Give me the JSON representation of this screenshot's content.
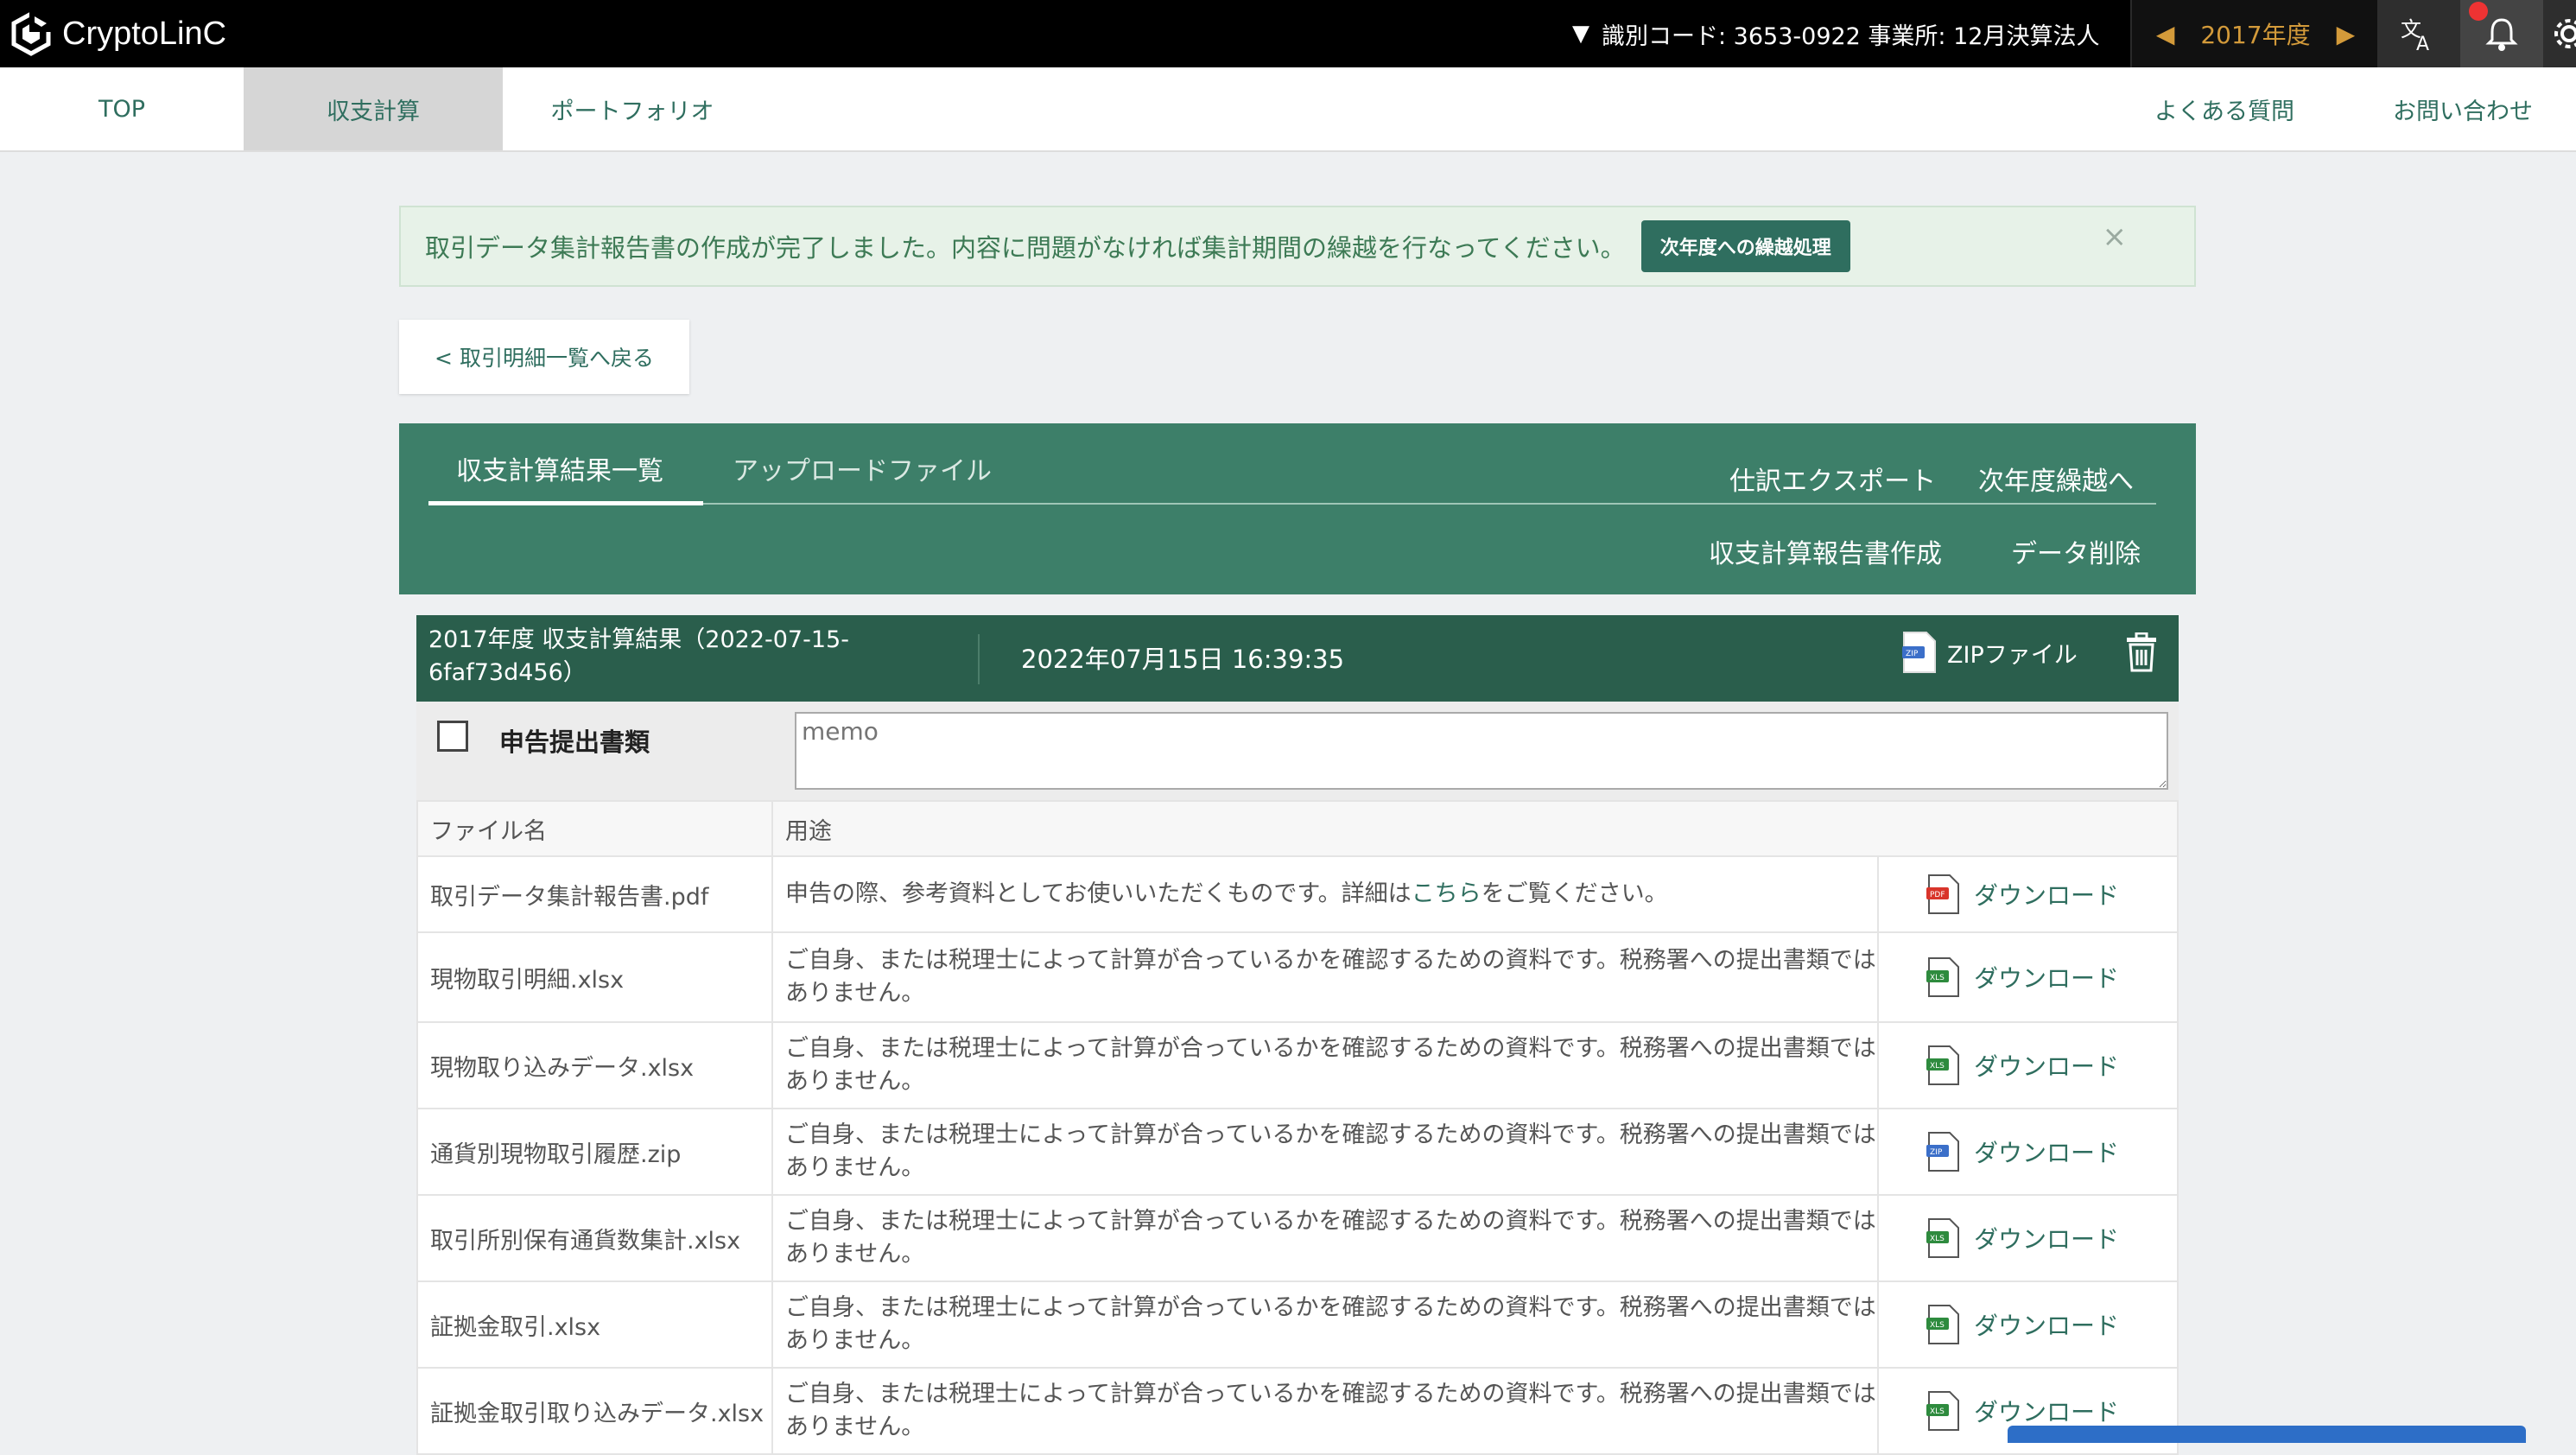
{
  "brand": {
    "name": "CryptoLinC"
  },
  "org": {
    "prefix": "▼",
    "text": "識別コード: 3653-0922  事業所: 12月決算法人"
  },
  "year": {
    "label": "2017年度",
    "prev": "◀",
    "next": "▶"
  },
  "nav": {
    "top": "TOP",
    "calc": "収支計算",
    "portfolio": "ポートフォリオ",
    "faq": "よくある質問",
    "contact": "お問い合わせ"
  },
  "alert": {
    "message": "取引データ集計報告書の作成が完了しました。内容に問題がなければ集計期間の繰越を行なってください。",
    "button": "次年度への繰越処理",
    "close": "×"
  },
  "back": "< 取引明細一覧へ戻る",
  "tabs": {
    "results": "収支計算結果一覧",
    "upload": "アップロードファイル"
  },
  "actions": {
    "export": "仕訳エクスポート",
    "carry": "次年度繰越へ",
    "report": "収支計算報告書作成",
    "delete": "データ削除"
  },
  "result": {
    "title": "2017年度 収支計算結果（2022-07-15-6faf73d456）",
    "datetime": "2022年07月15日 16:39:35",
    "zip_label": "ZIPファイル",
    "checkbox_label": "申告提出書類",
    "memo_placeholder": "memo"
  },
  "table": {
    "headers": [
      "ファイル名",
      "用途"
    ],
    "download_label": "ダウンロード",
    "rows": [
      {
        "name": "取引データ集計報告書.pdf",
        "type": "PDF",
        "desc_before": "申告の際、参考資料としてお使いいただくものです。詳細は",
        "desc_link": "こちら",
        "desc_after": "をご覧ください。"
      },
      {
        "name": "現物取引明細.xlsx",
        "type": "XLS",
        "desc": "ご自身、または税理士によって計算が合っているかを確認するための資料です。税務署への提出書類ではありません。"
      },
      {
        "name": "現物取り込みデータ.xlsx",
        "type": "XLS",
        "desc": "ご自身、または税理士によって計算が合っているかを確認するための資料です。税務署への提出書類ではありません。"
      },
      {
        "name": "通貨別現物取引履歴.zip",
        "type": "ZIP",
        "desc": "ご自身、または税理士によって計算が合っているかを確認するための資料です。税務署への提出書類ではありません。"
      },
      {
        "name": "取引所別保有通貨数集計.xlsx",
        "type": "XLS",
        "desc": "ご自身、または税理士によって計算が合っているかを確認するための資料です。税務署への提出書類ではありません。"
      },
      {
        "name": "証拠金取引.xlsx",
        "type": "XLS",
        "desc": "ご自身、または税理士によって計算が合っているかを確認するための資料です。税務署への提出書類ではありません。"
      },
      {
        "name": "証拠金取引取り込みデータ.xlsx",
        "type": "XLS",
        "desc": "ご自身、または税理士によって計算が合っているかを確認するための資料です。税務署への提出書類ではありません。"
      }
    ]
  },
  "icons": {
    "pdf_color": "#d9352b",
    "xls_color": "#2e8b3e",
    "zip_color": "#3b6fc9"
  },
  "colors": {
    "brand_green": "#3d7f69",
    "dark_green": "#2a5e4c",
    "accent_orange": "#d39a3a"
  }
}
